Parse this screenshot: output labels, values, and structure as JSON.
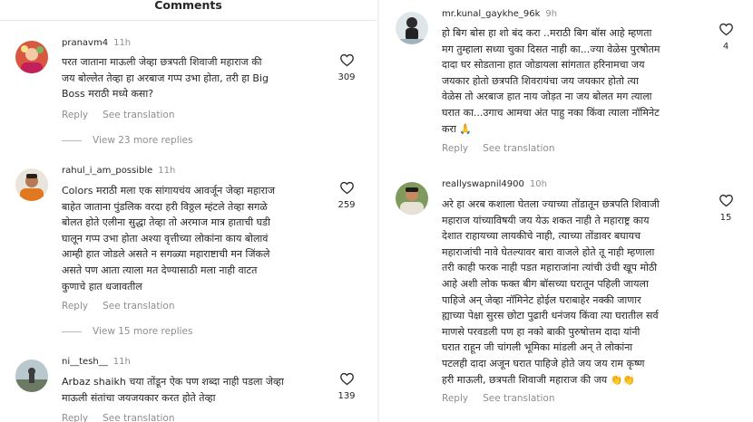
{
  "header": {
    "title": "Comments"
  },
  "left_comments": [
    {
      "username": "pranavm4",
      "time": "11h",
      "text": "परत जाताना माऊली जेव्हा छत्रपती  शिवाजी महाराज की\nजय बोल्लेत तेव्हा हा अरबाज गप्प उभा होता, तरी हा Big\nBoss मराठी मध्ये कसा?",
      "likes": "309",
      "reply_label": "Reply",
      "translate_label": "See translation",
      "view_more": "View 23 more replies"
    },
    {
      "username": "rahul_i_am_possible",
      "time": "11h",
      "text": "Colors मराठी  मला एक सांगायचंय आवर्जून जेव्हा महाराज\nबाहेत जाताना पुंडलिक वरदा हरी विठ्ठल म्हंटले तेव्हा सगळे\nबोलत होते एलीना सुद्धा तेव्हा तो अरमाज मात्र हाताची घडी\nघालून गप्प उभा होता अश्या वृत्तीच्या लोकांना काय बोलावं\nआम्ही हात जोडले असते न सगळ्या महाराष्टाची मन जिंकले\nअसते पण आता त्याला मत देण्यासाठी मला नाही वाटत\nकुणाचे हात धजावतील",
      "likes": "259",
      "reply_label": "Reply",
      "translate_label": "See translation",
      "view_more": "View 15 more replies"
    },
    {
      "username": "ni__tesh__",
      "time": "11h",
      "text": "Arbaz shaikh चया तोंडून ऐक पण शब्दा नाही पडला जेव्हा\nमाऊली संतांचा जयजयकार करत होते तेव्हा",
      "likes": "139",
      "reply_label": "Reply",
      "translate_label": "See translation"
    }
  ],
  "right_comments": [
    {
      "username": "mr.kunal_gaykhe_96k",
      "time": "9h",
      "text": "हो बिग बोस हा शो बंद करा ..मराठी बिग बॉस आहे म्हणता\nमग तुम्हाला सध्या चुका दिसत नाही का...ज्या वेळेस पुरषोतम\nदादा घर सोडताना हात जोडायला सांगतात हरिनामचा जय\nजयकार होतो छत्रपति शिवरायंचा जय जयकार होतो त्या\nवेळेस तो अरबाज हात नाय जोड़त ना जय बोलत मग त्याला\nघरात का...उगाच आमचा अंत पाहु नका किंवा त्याला नॉमिनेट\nकरा 🙏",
      "likes": "4",
      "reply_label": "Reply",
      "translate_label": "See translation"
    },
    {
      "username": "reallyswapnil4900",
      "time": "10h",
      "text": "अरे हा अरब कशाला घेतला ज्याच्या तोंडातून छत्रपति शिवाजी\nमहाराज यांच्याविषयी जय येऊ शकत नाही ते महाराष्ट्र काय\nदेशात राहायच्या लायकीचे नाही, त्याच्या तोंडावर बघायच\nमहाराजांची नावे घेतल्यावर बारा वाजले होते तू नाही म्हणाला\nतरी काही फरक नाही पडत महाराजांना त्यांची उंची खूप मोठी\nआहे अशी लोक फक्त बीग बॉसच्या घरातून पहिली जायला\nपाहिजे अन् जेव्हा नॉमिनेट होईल घराबाहेर नक्की जाणार\nह्याच्या पेक्षा सुरस छोटा पुढारी धनंजय किंवा त्या घरातील सर्व\nमाणसे परवडली पण हा नको बाकी पुरुषोत्तम दादा यांनी\nघरात राहून जी चांगली भूमिका मांडली अन् ते लोकांना\nपटलही दादा अजून घरात पाहिजे होते  जय जय राम कृष्ण\nहरी माऊली, छत्रपती शिवाजी महाराज की जय 👏👏",
      "likes": "15",
      "reply_label": "Reply",
      "translate_label": "See translation"
    }
  ]
}
